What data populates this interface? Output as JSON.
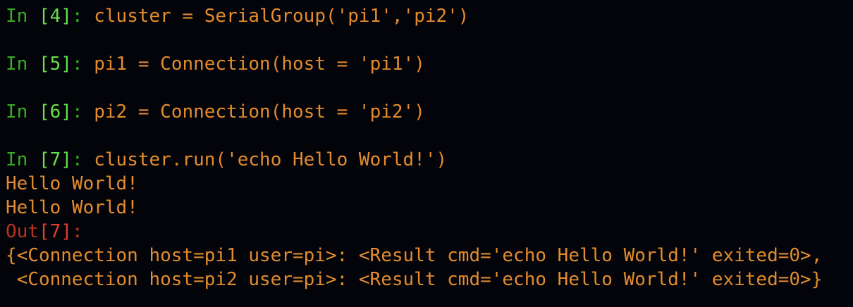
{
  "theme": {
    "background": "#020409",
    "prompt_green": "#3aa823",
    "prompt_number_green": "#67e04a",
    "out_prompt_red": "#b8331e",
    "text_orange": "#e38b2f"
  },
  "cells": [
    {
      "prompt_label": "In ",
      "number": "[4]",
      "suffix": ": ",
      "code": "cluster = SerialGroup('pi1','pi2')"
    },
    {
      "prompt_label": "In ",
      "number": "[5]",
      "suffix": ": ",
      "code": "pi1 = Connection(host = 'pi1')"
    },
    {
      "prompt_label": "In ",
      "number": "[6]",
      "suffix": ": ",
      "code": "pi2 = Connection(host = 'pi2')"
    },
    {
      "prompt_label": "In ",
      "number": "[7]",
      "suffix": ": ",
      "code": "cluster.run('echo Hello World!')",
      "stdout": [
        "Hello World!",
        "Hello World!"
      ],
      "out_label": "Out",
      "out_number": "[7]",
      "out_suffix": ":",
      "result": [
        "{<Connection host=pi1 user=pi>: <Result cmd='echo Hello World!' exited=0>,",
        " <Connection host=pi2 user=pi>: <Result cmd='echo Hello World!' exited=0>}"
      ]
    }
  ]
}
